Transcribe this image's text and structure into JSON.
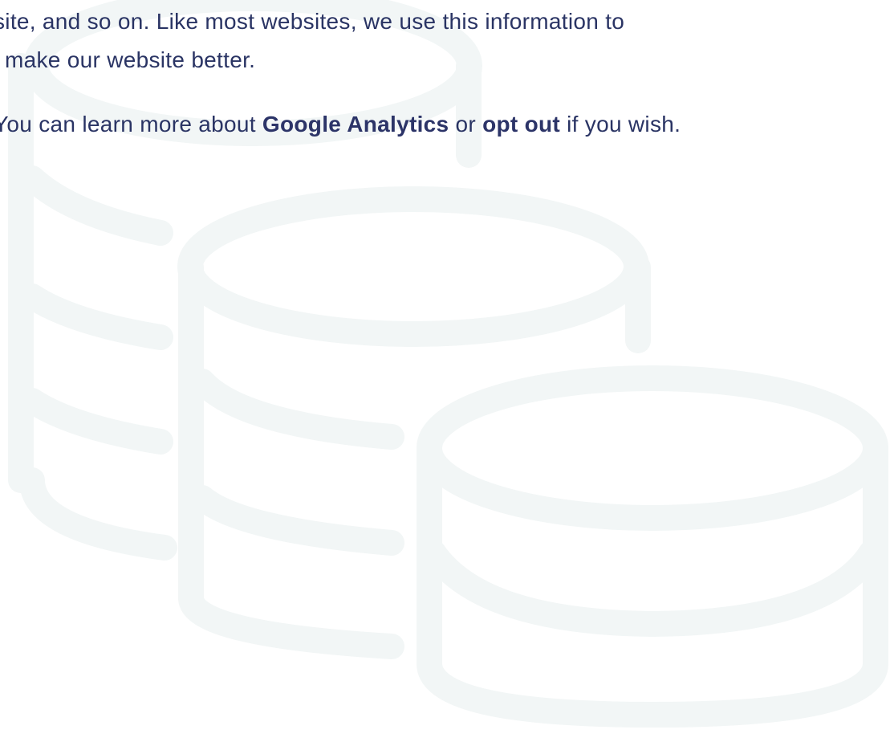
{
  "info": {
    "line1": "site, and so on. Like most websites, we use this information to",
    "line2": "make our website better.",
    "line3": {
      "lead": "You can learn more about ",
      "ga_link": "Google Analytics",
      "mid": " or ",
      "optout_link": "opt out",
      "tail": " if you wish."
    }
  },
  "colors": {
    "text": "#2a3464",
    "link": "#2c3468",
    "illustration": "#f2f6f6",
    "background": "#ffffff"
  },
  "illustration": {
    "icon": "coin-stacks-icon"
  }
}
